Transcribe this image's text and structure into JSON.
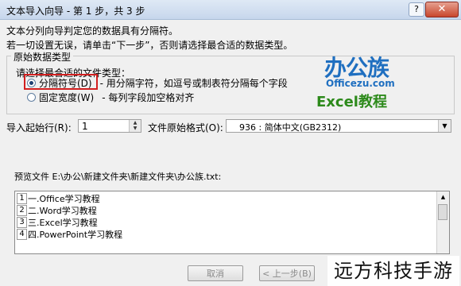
{
  "window": {
    "title": "文本导入向导 - 第 1 步，共 3 步",
    "help_label": "?",
    "close_label": "✕"
  },
  "description": {
    "line1": "文本分列向导判定您的数据具有分隔符。",
    "line2": "若一切设置无误，请单击“下一步”，否则请选择最合适的数据类型。"
  },
  "original_data_type": {
    "legend": "原始数据类型",
    "subtitle": "请选择最合适的文件类型：",
    "options": [
      {
        "label": "分隔符号(D)",
        "description": "- 用分隔字符，如逗号或制表符分隔每个字段",
        "selected": true
      },
      {
        "label": "固定宽度(W)",
        "description": "- 每列字段加空格对齐",
        "selected": false
      }
    ]
  },
  "logo": {
    "brand_cn": "办公族",
    "site": "Officezu.com",
    "tagline": "Excel教程"
  },
  "import_start_row": {
    "label": "导入起始行(R):",
    "value": "1"
  },
  "file_origin": {
    "label": "文件原始格式(O):",
    "value": "936 : 简体中文(GB2312)"
  },
  "preview": {
    "label": "预览文件 E:\\办公\\新建文件夹\\新建文件夹\\办公族.txt:",
    "rows": [
      {
        "num": "1",
        "text": "一.Office学习教程"
      },
      {
        "num": "2",
        "text": "二.Word学习教程"
      },
      {
        "num": "3",
        "text": "三.Excel学习教程"
      },
      {
        "num": "4",
        "text": "四.PowerPoint学习教程"
      }
    ]
  },
  "buttons": {
    "cancel": "取消",
    "back": "< 上一步(B)"
  },
  "watermark": "远方科技手游",
  "colors": {
    "highlight_border": "#d21f1f",
    "logo_blue": "#1f6fc0",
    "logo_green": "#2d8a1b"
  }
}
